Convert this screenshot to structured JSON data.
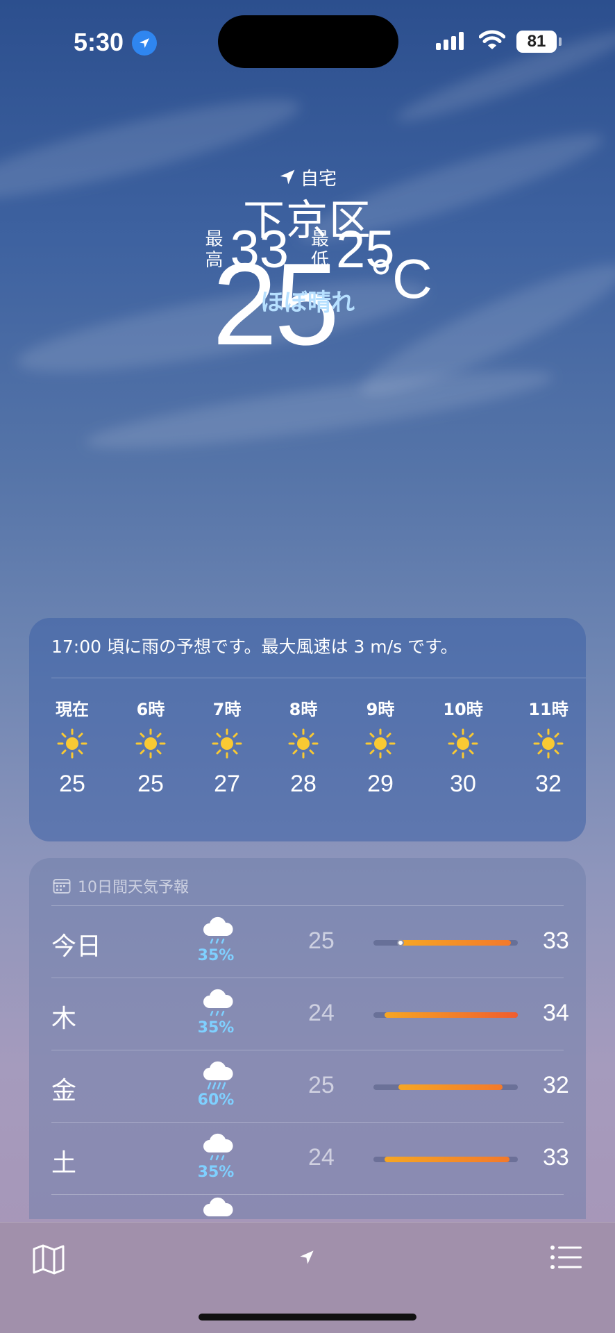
{
  "status_bar": {
    "time": "5:30",
    "battery": "81"
  },
  "header": {
    "home_label": "自宅",
    "city": "下京区",
    "temperature": "25",
    "unit": "°C",
    "high_label_1": "最",
    "high_label_2": "高",
    "high": "33",
    "low_label_1": "最",
    "low_label_2": "低",
    "low": "25",
    "condition": "ほぼ晴れ"
  },
  "hourly": {
    "summary": "17:00 頃に雨の予想です。最大風速は 3 m/s です。",
    "items": [
      {
        "label": "現在",
        "icon": "sun-icon",
        "temp": "25"
      },
      {
        "label": "6時",
        "icon": "sun-icon",
        "temp": "25"
      },
      {
        "label": "7時",
        "icon": "sun-icon",
        "temp": "27"
      },
      {
        "label": "8時",
        "icon": "sun-icon",
        "temp": "28"
      },
      {
        "label": "9時",
        "icon": "sun-icon",
        "temp": "29"
      },
      {
        "label": "10時",
        "icon": "sun-icon",
        "temp": "30"
      },
      {
        "label": "11時",
        "icon": "sun-icon",
        "temp": "32"
      }
    ]
  },
  "daily": {
    "title": "10日間天気予報",
    "items": [
      {
        "day": "今日",
        "icon": "cloud-rain-icon",
        "precip": "35%",
        "low": "25",
        "high": "33"
      },
      {
        "day": "木",
        "icon": "cloud-rain-icon",
        "precip": "35%",
        "low": "24",
        "high": "34"
      },
      {
        "day": "金",
        "icon": "cloud-heavy-rain-icon",
        "precip": "60%",
        "low": "25",
        "high": "32"
      },
      {
        "day": "土",
        "icon": "cloud-rain-icon",
        "precip": "35%",
        "low": "24",
        "high": "33"
      }
    ]
  },
  "toolbar": {
    "left_icon": "map-icon",
    "center_icon": "location-arrow-icon",
    "right_icon": "list-icon"
  },
  "colors": {
    "precip": "#7fd0ff",
    "condition": "#b7e0ff",
    "bar_start": "#f6a623",
    "bar_end": "#f3792b",
    "sun": "#f9c933"
  }
}
